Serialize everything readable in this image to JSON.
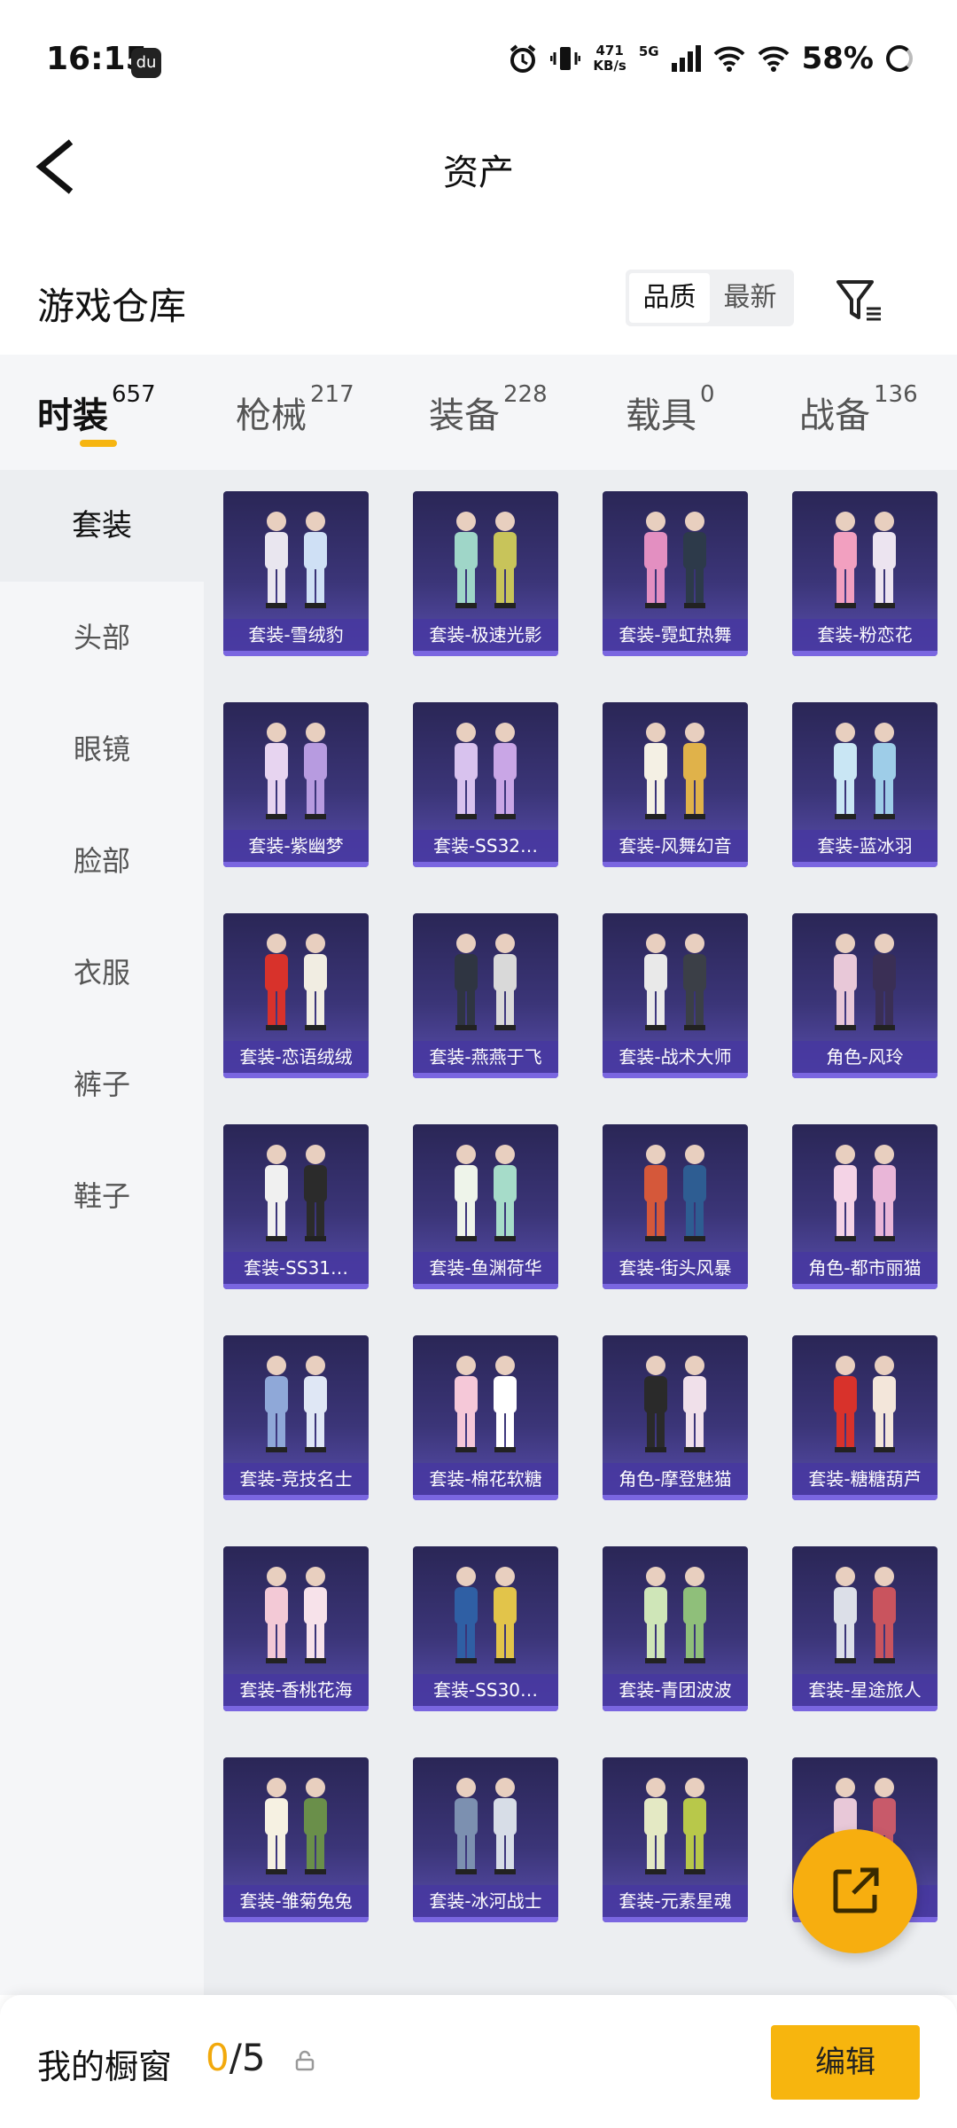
{
  "status_bar": {
    "time": "16:15",
    "app_icon": "du",
    "speed_value": "471",
    "speed_unit": "KB/s",
    "network": "5G",
    "battery": "58%"
  },
  "nav": {
    "title": "资产"
  },
  "header": {
    "title": "游戏仓库",
    "sort_options": [
      "品质",
      "最新"
    ],
    "sort_selected": "品质"
  },
  "tabs": [
    {
      "label": "时装",
      "count": "657"
    },
    {
      "label": "枪械",
      "count": "217"
    },
    {
      "label": "装备",
      "count": "228"
    },
    {
      "label": "载具",
      "count": "0"
    },
    {
      "label": "战备",
      "count": "136"
    }
  ],
  "sidebar": {
    "items": [
      {
        "label": "套装"
      },
      {
        "label": "头部"
      },
      {
        "label": "眼镜"
      },
      {
        "label": "脸部"
      },
      {
        "label": "衣服"
      },
      {
        "label": "裤子"
      },
      {
        "label": "鞋子"
      }
    ]
  },
  "items": [
    {
      "label": "套装-雪绒豹"
    },
    {
      "label": "套装-极速光影"
    },
    {
      "label": "套装-霓虹热舞"
    },
    {
      "label": "套装-粉恋花"
    },
    {
      "label": "套装-紫幽梦"
    },
    {
      "label": "套装-SS32…"
    },
    {
      "label": "套装-风舞幻音"
    },
    {
      "label": "套装-蓝冰羽"
    },
    {
      "label": "套装-恋语绒绒"
    },
    {
      "label": "套装-燕燕于飞"
    },
    {
      "label": "套装-战术大师"
    },
    {
      "label": "角色-风玲"
    },
    {
      "label": "套装-SS31…"
    },
    {
      "label": "套装-鱼渊荷华"
    },
    {
      "label": "套装-街头风暴"
    },
    {
      "label": "角色-都市丽猫"
    },
    {
      "label": "套装-竞技名士"
    },
    {
      "label": "套装-棉花软糖"
    },
    {
      "label": "角色-摩登魅猫"
    },
    {
      "label": "套装-糖糖葫芦"
    },
    {
      "label": "套装-香桃花海"
    },
    {
      "label": "套装-SS30…"
    },
    {
      "label": "套装-青团波波"
    },
    {
      "label": "套装-星途旅人"
    },
    {
      "label": "套装-雏菊兔兔"
    },
    {
      "label": "套装-冰河战士"
    },
    {
      "label": "套装-元素星魂"
    },
    {
      "label": "川"
    }
  ],
  "bottom_bar": {
    "title": "我的橱窗",
    "current": "0",
    "sep_total": "/5",
    "edit_label": "编辑"
  },
  "colors": {
    "accent": "#f7b50e",
    "card_bg": "#3b3578",
    "card_label": "#4637a0"
  }
}
